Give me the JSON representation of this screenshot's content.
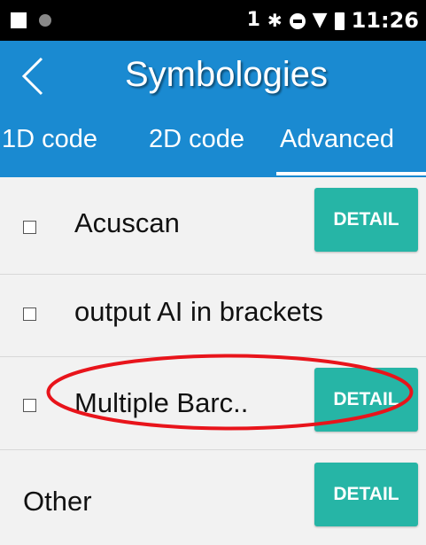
{
  "status_bar": {
    "sim_number": "1",
    "time": "11:26",
    "icons": [
      "image-icon",
      "dot-icon",
      "bluetooth-icon",
      "do-not-disturb-icon",
      "wifi-icon",
      "battery-icon"
    ]
  },
  "header": {
    "title": "Symbologies",
    "back_icon": "back-chevron-icon"
  },
  "tabs": [
    {
      "label": "1D code",
      "selected": false
    },
    {
      "label": "2D code",
      "selected": false
    },
    {
      "label": "Advanced",
      "selected": true
    }
  ],
  "items": [
    {
      "label": "Acuscan",
      "has_checkbox": true,
      "checked": false,
      "has_detail": true
    },
    {
      "label": "output AI in brackets",
      "has_checkbox": true,
      "checked": false,
      "has_detail": false
    },
    {
      "label": "Multiple Barc..",
      "has_checkbox": true,
      "checked": false,
      "has_detail": true
    },
    {
      "label": "Other",
      "has_checkbox": false,
      "has_detail": true
    }
  ],
  "detail_label": "DETAIL",
  "colors": {
    "app_bar": "#1a8ad1",
    "detail_button": "#26b5a6",
    "annotation": "#e8141b",
    "background": "#f2f2f2"
  }
}
